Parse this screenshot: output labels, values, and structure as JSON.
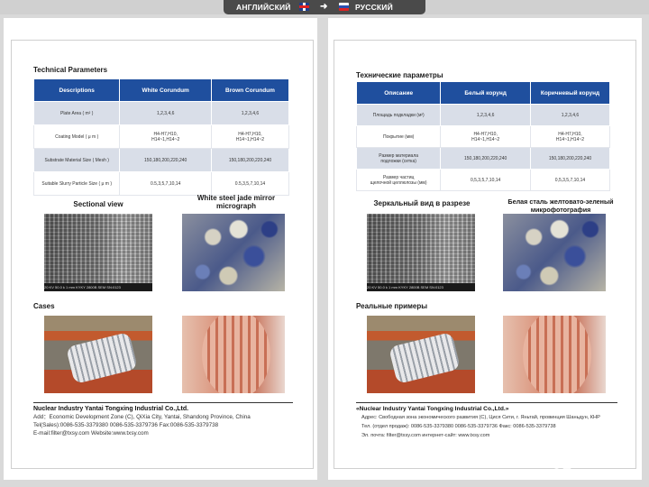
{
  "lang_bar": {
    "left_lang": "АНГЛИЙСКИЙ",
    "right_lang": "РУССКИЙ",
    "arrow": "➜"
  },
  "left": {
    "heading": "Technical Parameters",
    "table": {
      "headers": [
        "Descriptions",
        "White Corundum",
        "Brown Corundum"
      ],
      "rows": [
        [
          "Plate Area ( m² )",
          "1,2,3,4,6",
          "1,2,3,4,6"
        ],
        [
          "Coating Model ( μ m )",
          "H4-H7,H10,\nH14~1,H14~2",
          "H4-H7,H10,\nH14~1,H14~2"
        ],
        [
          "Substrate Material Size ( Mesh )",
          "150,180,200,220,240",
          "150,180,200,220,240"
        ],
        [
          "Suitable Slurry Particle Size ( μ m )",
          "0.5,3,5,7,10,14",
          "0.5,3,5,7,10,14"
        ]
      ]
    },
    "caption_sectional": "Sectional view",
    "caption_micro": "White steel jade mirror\nmicrograph",
    "sem_bar": "20 KV     50.0 k      1 mm     KYKY 2800B SEM    SN:0123",
    "cases": "Cases",
    "company": "Nuclear Industry Yantai Tongxing Industrial Co.,Ltd.",
    "info_lines": [
      "Add：Economic Development Zone (C), QiXia City, Yantai, Shandong Province, China",
      "Tel(Sales):0086-535-3379380   0086-535-3379736        Fax:0086-535-3379738",
      "E-mail:filter@txsy.com          Website:www.txsy.com"
    ]
  },
  "right": {
    "heading": "Технические параметры",
    "table": {
      "headers": [
        "Описание",
        "Белый корунд",
        "Коричневый корунд"
      ],
      "rows": [
        [
          "Площадь подкладки (м²)",
          "1,2,3,4,6",
          "1,2,3,4,6"
        ],
        [
          "Покрытие (мм)",
          "H4-H7,H10,\nH14~1,H14~2",
          "H4-H7,H10,\nH14~1,H14~2"
        ],
        [
          "Размер материала\nподложки (сетка)",
          "150,180,200,220,240",
          "150,180,200,220,240"
        ],
        [
          "Размер частиц\nщелочной целлюлозы (мм)",
          "0,5,3,5,7,10,14",
          "0,5,3,5,7,10,14"
        ]
      ]
    },
    "caption_sectional": "Зеркальный вид в разрезе",
    "caption_micro": "Белая сталь желтовато-зеленый\nмикрофотография",
    "sem_bar": "20 KV     50.0 k      1 mm     KYKY 2800B SEM    SN:0123",
    "cases": "Реальные примеры",
    "company": "«Nuclear Industry Yantai Tongxing Industrial Co.,Ltd.»",
    "info_lines": [
      "Адрес: Свободная зона экономического развития (С), Цися Сити, г. Яньтай, провинция Шаньдун, КНР",
      "Тел. (отдел продаж): 0086-535-3379380   0086-535-3379736    Факс: 0086-535-3379738",
      "Эл. почта: filter@txsy.com   интернет-сайт: www.txsy.com"
    ]
  },
  "watermark": {
    "text": "Avito"
  }
}
